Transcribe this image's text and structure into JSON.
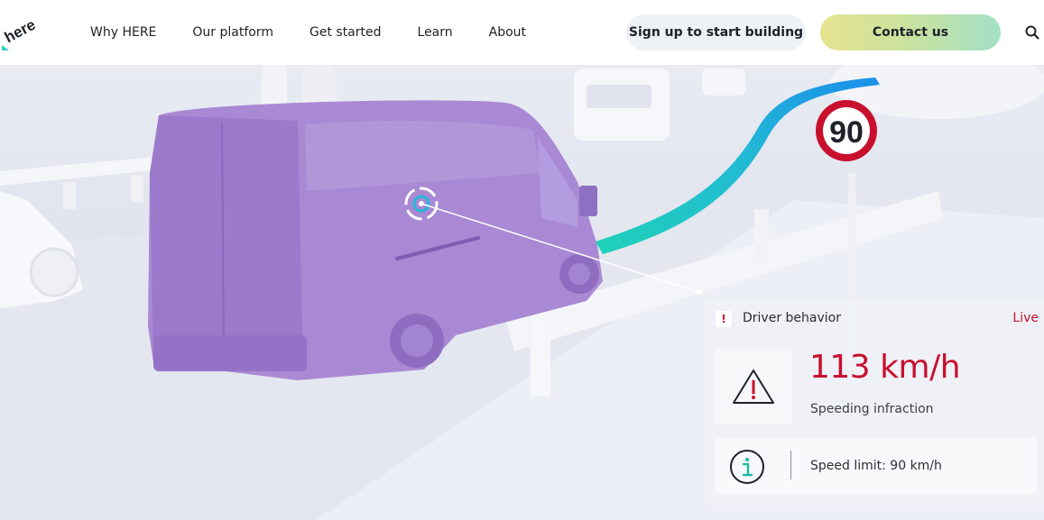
{
  "header": {
    "logo_text": "here",
    "nav": [
      {
        "label": "Why HERE"
      },
      {
        "label": "Our platform"
      },
      {
        "label": "Get started"
      },
      {
        "label": "Learn"
      },
      {
        "label": "About"
      }
    ],
    "signup_label": "Sign up to start building",
    "contact_label": "Contact us",
    "search_icon": "search-icon"
  },
  "hero": {
    "speed_sign": "90",
    "panel": {
      "title": "Driver behavior",
      "status": "Live",
      "speed": "113 km/h",
      "infraction": "Speeding infraction",
      "limit": "Speed limit: 90 km/h"
    }
  },
  "colors": {
    "accent_red": "#c8102e",
    "van": "#a989d4",
    "route_start": "#1fd1b8",
    "route_end": "#1a8fe8"
  }
}
